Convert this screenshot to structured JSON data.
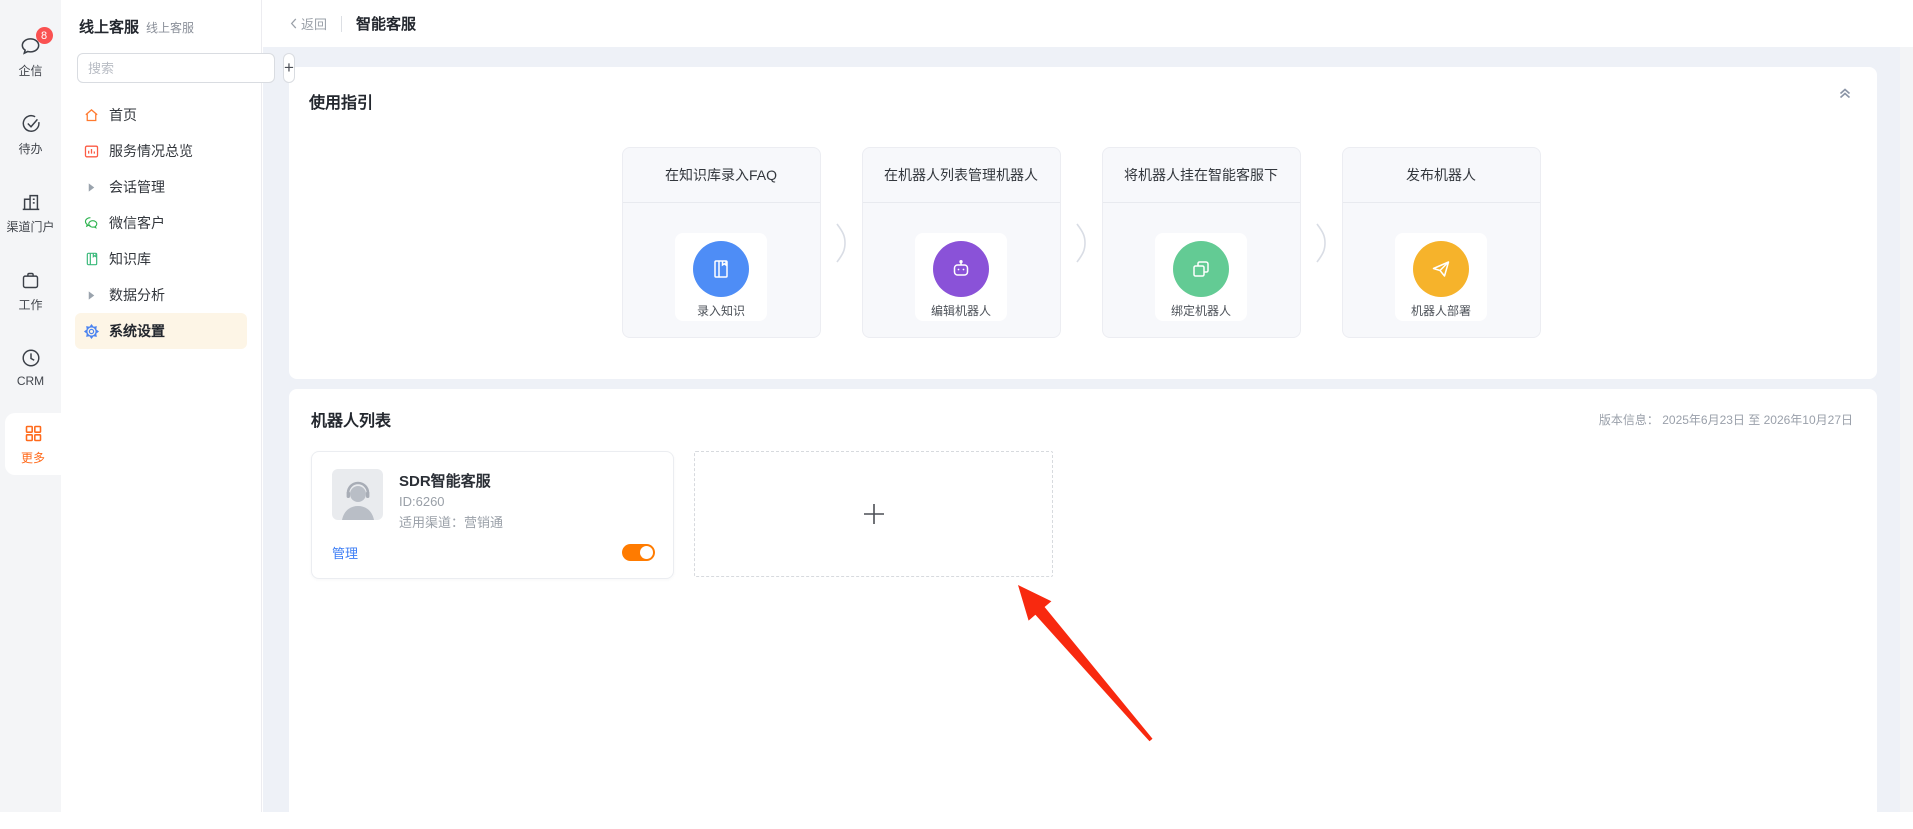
{
  "rail": {
    "items": [
      {
        "label": "企信",
        "badge": "8"
      },
      {
        "label": "待办"
      },
      {
        "label": "渠道门户"
      },
      {
        "label": "工作"
      },
      {
        "label": "CRM"
      },
      {
        "label": "更多"
      }
    ]
  },
  "sidebar": {
    "title": "线上客服",
    "subtitle": "线上客服",
    "search_placeholder": "搜索",
    "add_button": "+",
    "items": [
      {
        "label": "首页"
      },
      {
        "label": "服务情况总览"
      },
      {
        "label": "会话管理"
      },
      {
        "label": "微信客户"
      },
      {
        "label": "知识库"
      },
      {
        "label": "数据分析"
      },
      {
        "label": "系统设置"
      }
    ]
  },
  "header": {
    "back": "返回",
    "title": "智能客服"
  },
  "guide": {
    "title": "使用指引",
    "steps": [
      {
        "header": "在知识库录入FAQ",
        "label": "录入知识",
        "color": "#4e8df6"
      },
      {
        "header": "在机器人列表管理机器人",
        "label": "编辑机器人",
        "color": "#8a52d8"
      },
      {
        "header": "将机器人挂在智能客服下",
        "label": "绑定机器人",
        "color": "#63cb94"
      },
      {
        "header": "发布机器人",
        "label": "机器人部署",
        "color": "#f6b32b"
      }
    ]
  },
  "robots": {
    "title": "机器人列表",
    "version_label": "版本信息：",
    "version_value": "2025年6月23日 至 2026年10月27日",
    "cards": [
      {
        "name": "SDR智能客服",
        "id": "ID:6260",
        "channel": "适用渠道：营销通",
        "manage": "管理",
        "enabled": true
      }
    ]
  },
  "colors": {
    "accent_orange": "#ff6a1b",
    "toggle_on": "#ff7b00",
    "link_blue": "#3d7ef5",
    "badge_red": "#fa5151",
    "arrow_red": "#f8290f",
    "selected_menu_bg": "#fdf5e6"
  }
}
